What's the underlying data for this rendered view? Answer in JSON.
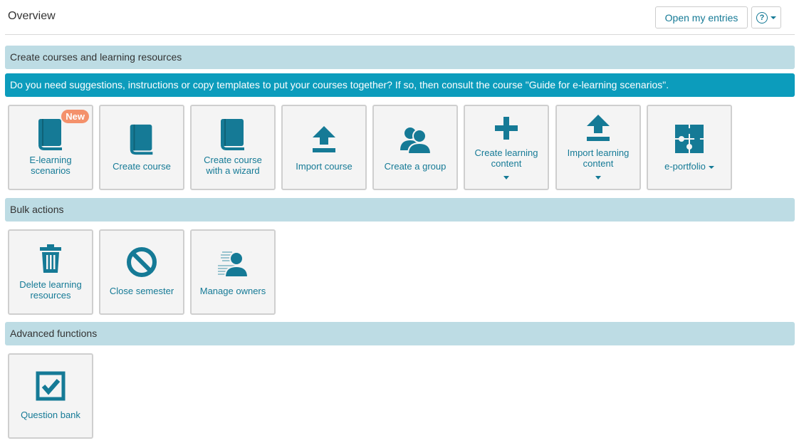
{
  "header": {
    "title": "Overview",
    "open_entries_label": "Open my entries",
    "help_icon": "help-circle-icon"
  },
  "sections": {
    "create": "Create courses and learning resources",
    "info": "Do you need suggestions, instructions or copy templates to put your courses together? If so, then consult the course \"Guide for e-learning scenarios\".",
    "bulk": "Bulk actions",
    "advanced": "Advanced functions"
  },
  "tiles": {
    "elearning": {
      "label1": "E-learning",
      "label2": "scenarios",
      "badge": "New",
      "icon": "book-icon"
    },
    "create_course": {
      "label": "Create course",
      "icon": "book-icon"
    },
    "wizard": {
      "label1": "Create course",
      "label2": "with a wizard",
      "icon": "book-icon"
    },
    "import_course": {
      "label": "Import course",
      "icon": "upload-icon"
    },
    "create_group": {
      "label": "Create a group",
      "icon": "group-icon"
    },
    "create_content": {
      "label1": "Create learning",
      "label2": "content",
      "icon": "plus-icon"
    },
    "import_content": {
      "label1": "Import learning",
      "label2": "content",
      "icon": "upload-icon"
    },
    "eportfolio": {
      "label": "e-portfolio",
      "icon": "puzzle-icon"
    },
    "delete": {
      "label1": "Delete learning",
      "label2": "resources",
      "icon": "trash-icon"
    },
    "close_semester": {
      "label": "Close semester",
      "icon": "ban-icon"
    },
    "owners": {
      "label": "Manage owners",
      "icon": "owners-icon"
    },
    "question_bank": {
      "label": "Question bank",
      "icon": "checkbox-icon"
    }
  },
  "colors": {
    "accent": "#157a96",
    "section_bg": "#bddce4",
    "info_bg": "#0c9cbc",
    "badge": "#f4916b"
  }
}
